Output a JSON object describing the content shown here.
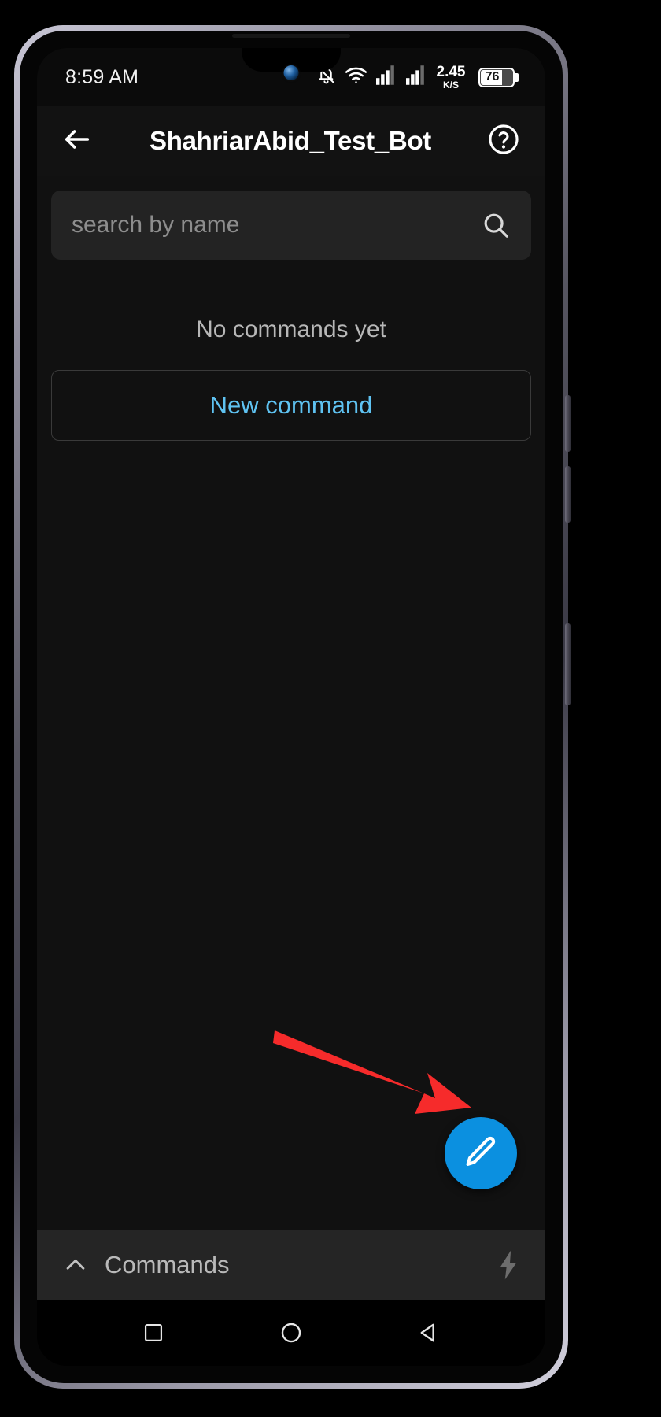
{
  "status_bar": {
    "clock": "8:59 AM",
    "icons": [
      "bell-muted-icon",
      "wifi-icon",
      "signal-sim1-icon",
      "signal-sim2-icon"
    ],
    "net_speed_value": "2.45",
    "net_speed_unit": "K/S",
    "battery_level": "76"
  },
  "header": {
    "back_icon": "arrow-left-icon",
    "title": "ShahriarAbid_Test_Bot",
    "help_icon": "question-circle-icon"
  },
  "search": {
    "placeholder": "search by name",
    "value": "",
    "icon": "search-icon"
  },
  "content": {
    "empty_state": "No commands yet",
    "new_command_label": "New command"
  },
  "fab": {
    "icon": "pencil-icon",
    "color": "#0b90e0"
  },
  "annotation": {
    "arrow_color": "#f62b2b",
    "points_to": "fab-edit-button"
  },
  "commands_panel": {
    "chevron_icon": "chevron-up-icon",
    "label": "Commands",
    "action_icon": "lightning-bolt-icon"
  },
  "nav_bar": {
    "recent_icon": "square-icon",
    "home_icon": "circle-icon",
    "back_icon": "triangle-back-icon"
  },
  "colors": {
    "accent_blue": "#5fc3f2",
    "fab_blue": "#0b90e0",
    "arrow_red": "#f62b2b",
    "app_background": "#111111",
    "header_background": "#121212",
    "search_background": "#232323",
    "panel_background": "#252525"
  }
}
